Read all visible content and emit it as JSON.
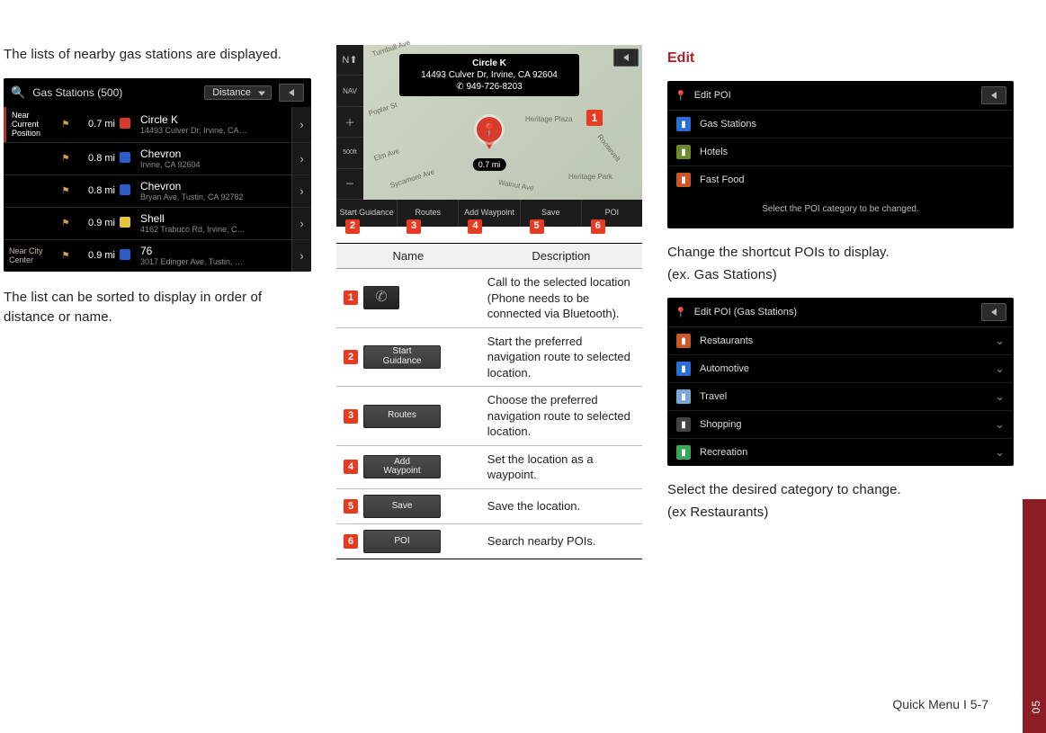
{
  "left": {
    "para1": "The lists of nearby gas stations are displayed.",
    "para2": "The list can be sorted to display in order of distance or name.",
    "shot": {
      "title": "Gas Stations (500)",
      "sort": "Distance",
      "rows": [
        {
          "label": "Near Current Position",
          "dist": "0.7 mi",
          "brand_color": "#d63a2b",
          "name": "Circle K",
          "addr": "14493 Culver Dr, Irvine, CA…"
        },
        {
          "label": "",
          "dist": "0.8 mi",
          "brand_color": "#2a5ec8",
          "name": "Chevron",
          "addr": "Irvine, CA 92604"
        },
        {
          "label": "",
          "dist": "0.8 mi",
          "brand_color": "#2a5ec8",
          "name": "Chevron",
          "addr": "Bryan Ave, Tustin, CA 92782"
        },
        {
          "label": "",
          "dist": "0.9 mi",
          "brand_color": "#e7c63b",
          "name": "Shell",
          "addr": "4162 Trabuco Rd, Irvine, C…"
        },
        {
          "label": "Near City Center",
          "dist": "0.9 mi",
          "brand_color": "#2a5ec8",
          "name": "76",
          "addr": "3017 Edinger Ave, Tustin, …"
        }
      ]
    }
  },
  "mid": {
    "map": {
      "poi_name": "Circle K",
      "poi_addr": "14493 Culver Dr, Irvine, CA 92604",
      "poi_phone": "✆ 949-726-8203",
      "dist": "0.7 mi",
      "streets": [
        "Turnbull Ave",
        "Poplar St",
        "Elm Ave",
        "Sycamore Ave",
        "Heritage Plaza",
        "Walnut Ave",
        "Heritage Park",
        "Roosevelt"
      ],
      "buttons": [
        "Start Guidance",
        "Routes",
        "Add Waypoint",
        "Save",
        "POI"
      ]
    },
    "table": {
      "head_name": "Name",
      "head_desc": "Description",
      "rows": [
        {
          "n": "1",
          "label": "",
          "twoline": false,
          "phone": true,
          "desc": "Call to the selected location (Phone needs to be connected via Bluetooth)."
        },
        {
          "n": "2",
          "label": "Start Guidance",
          "twoline": true,
          "phone": false,
          "desc": "Start the preferred navigation route to selected location."
        },
        {
          "n": "3",
          "label": "Routes",
          "twoline": false,
          "phone": false,
          "desc": "Choose the preferred navigation route to selected location."
        },
        {
          "n": "4",
          "label": "Add Waypoint",
          "twoline": true,
          "phone": false,
          "desc": "Set the location as a waypoint."
        },
        {
          "n": "5",
          "label": "Save",
          "twoline": false,
          "phone": false,
          "desc": "Save the location."
        },
        {
          "n": "6",
          "label": "POI",
          "twoline": false,
          "phone": false,
          "desc": "Search nearby POIs."
        }
      ]
    }
  },
  "right": {
    "heading": "Edit",
    "para1a": "Change the shortcut POIs to display.",
    "para1b": "(ex. Gas Stations)",
    "para2a": "Select the desired category to change.",
    "para2b": "(ex Restaurants)",
    "shot1": {
      "title": "Edit POI",
      "footer": "Select the POI category to be changed.",
      "items": [
        {
          "label": "Gas Stations",
          "color": "#2a6ed4"
        },
        {
          "label": "Hotels",
          "color": "#6c8a2e"
        },
        {
          "label": "Fast Food",
          "color": "#c8572a"
        }
      ]
    },
    "shot2": {
      "title": "Edit POI (Gas Stations)",
      "items": [
        {
          "label": "Restaurants",
          "color": "#c8572a"
        },
        {
          "label": "Automotive",
          "color": "#2a6ed4"
        },
        {
          "label": "Travel",
          "color": "#7aa6d6"
        },
        {
          "label": "Shopping",
          "color": "#444"
        },
        {
          "label": "Recreation",
          "color": "#3aa658"
        }
      ]
    }
  },
  "chrome": {
    "page_label": "Quick Menu I 5-7",
    "section_no": "05"
  }
}
